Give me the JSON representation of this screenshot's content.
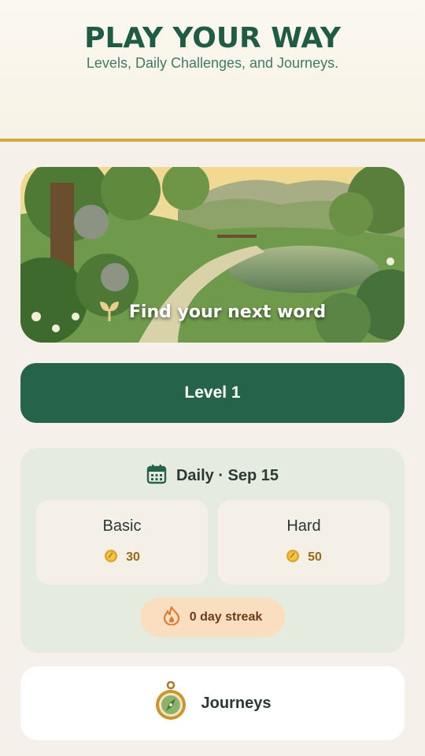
{
  "header": {
    "title": "PLAY YOUR WAY",
    "subtitle": "Levels, Daily Challenges, and Journeys."
  },
  "hero": {
    "caption": "Find your next word",
    "icon": "sprout-icon"
  },
  "level_button": {
    "label": "Level 1"
  },
  "daily": {
    "icon": "calendar-icon",
    "title": "Daily · Sep 15",
    "modes": [
      {
        "name": "Basic",
        "reward": "30",
        "icon": "coin-icon"
      },
      {
        "name": "Hard",
        "reward": "50",
        "icon": "coin-icon"
      }
    ],
    "streak": {
      "icon": "flame-icon",
      "label": "0 day streak"
    }
  },
  "journeys": {
    "icon": "compass-icon",
    "label": "Journeys"
  },
  "colors": {
    "accent": "#26634b",
    "gold": "#d2a846",
    "background": "#f5f1ea"
  }
}
